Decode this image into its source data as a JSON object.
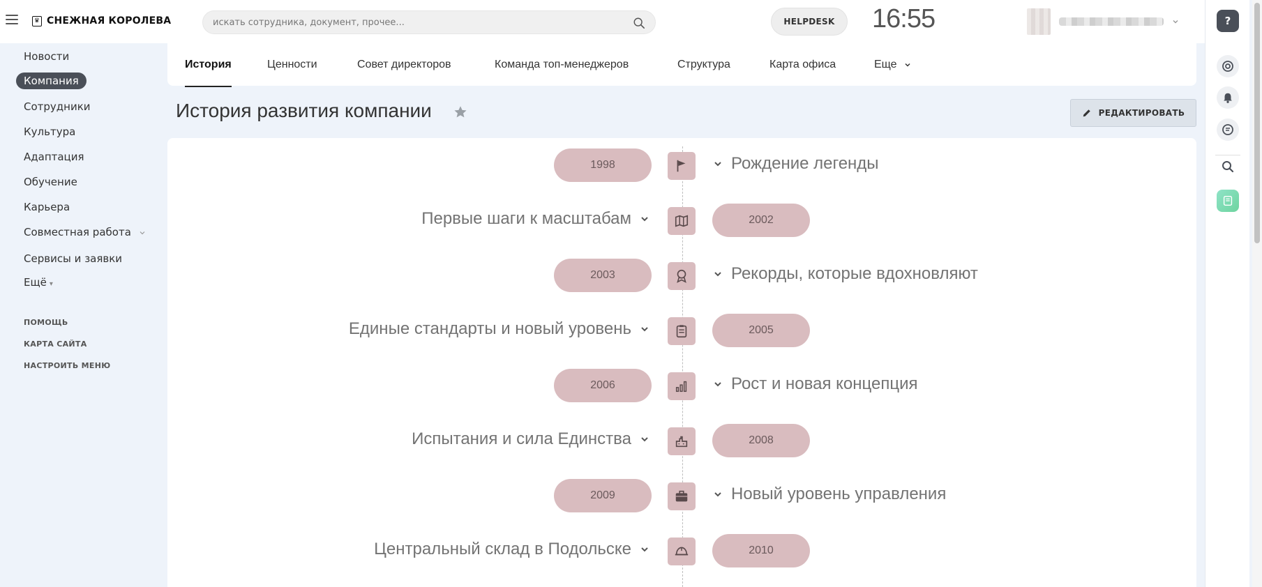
{
  "header": {
    "brand": "СНЕЖНАЯ КОРОЛЕВА",
    "search_placeholder": "искать сотрудника, документ, прочее...",
    "helpdesk_label": "HELPDESK",
    "clock": "16:55"
  },
  "sidebar": {
    "items": [
      {
        "label": "Новости"
      },
      {
        "label": "Компания",
        "active": true
      },
      {
        "label": "Сотрудники"
      },
      {
        "label": "Культура"
      },
      {
        "label": "Адаптация"
      },
      {
        "label": "Обучение"
      },
      {
        "label": "Карьера"
      },
      {
        "label": "Совместная работа"
      },
      {
        "label": "Сервисы и заявки"
      },
      {
        "label": "Ещё"
      }
    ],
    "links": [
      {
        "label": "ПОМОЩЬ"
      },
      {
        "label": "КАРТА САЙТА"
      },
      {
        "label": "НАСТРОИТЬ МЕНЮ"
      }
    ]
  },
  "tabs": [
    {
      "label": "История",
      "active": true
    },
    {
      "label": "Ценности"
    },
    {
      "label": "Совет директоров"
    },
    {
      "label": "Команда топ-менеджеров"
    },
    {
      "label": "Структура"
    },
    {
      "label": "Карта офиса"
    },
    {
      "label": "Еще"
    }
  ],
  "page": {
    "title": "История развития компании",
    "edit_label": "РЕДАКТИРОВАТЬ"
  },
  "timeline": [
    {
      "year": "1998",
      "title": "Рождение легенды",
      "icon": "flag-icon"
    },
    {
      "year": "2002",
      "title": "Первые шаги к масштабам",
      "icon": "map-icon"
    },
    {
      "year": "2003",
      "title": "Рекорды, которые вдохновляют",
      "icon": "award-icon"
    },
    {
      "year": "2005",
      "title": "Единые стандарты и новый уровень",
      "icon": "clipboard-icon"
    },
    {
      "year": "2006",
      "title": "Рост и новая концепция",
      "icon": "bar-chart-icon"
    },
    {
      "year": "2008",
      "title": "Испытания и сила Единства",
      "icon": "factory-icon"
    },
    {
      "year": "2009",
      "title": "Новый уровень управления",
      "icon": "briefcase-icon"
    },
    {
      "year": "2010",
      "title": "Центральный склад в Подольске",
      "icon": "hard-hat-icon"
    }
  ],
  "right_rail": {
    "help_label": "?"
  },
  "colors": {
    "accent_dark": "#4a4f58",
    "timeline_badge": "#d9bcbf",
    "page_background": "#eef3fa"
  }
}
